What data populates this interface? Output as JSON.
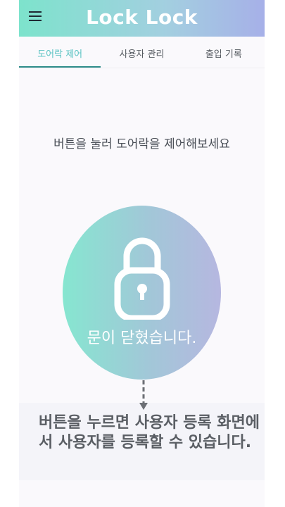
{
  "app": {
    "title": "Lock Lock"
  },
  "header": {
    "menu_icon": "hamburger-menu-icon"
  },
  "tabs": [
    {
      "label": "도어락 제어",
      "active": true
    },
    {
      "label": "사용자 관리",
      "active": false
    },
    {
      "label": "출입 기록",
      "active": false
    }
  ],
  "main": {
    "instruction": "버튼을 눌러 도어락을 제어해보세요",
    "lock_icon": "padlock-icon",
    "status": "문이 닫혔습니다."
  },
  "tooltip": {
    "text": "버튼을 누르면 사용자 등록 화면에서 사용자를 등록할 수 있습니다.",
    "arrow_icon": "dashed-arrow-down-icon"
  },
  "colors": {
    "accent": "#58c2c2",
    "tab_underline": "#2e8c8a",
    "gradient_start": "#7de3cc",
    "gradient_end": "#a6b0e8"
  }
}
